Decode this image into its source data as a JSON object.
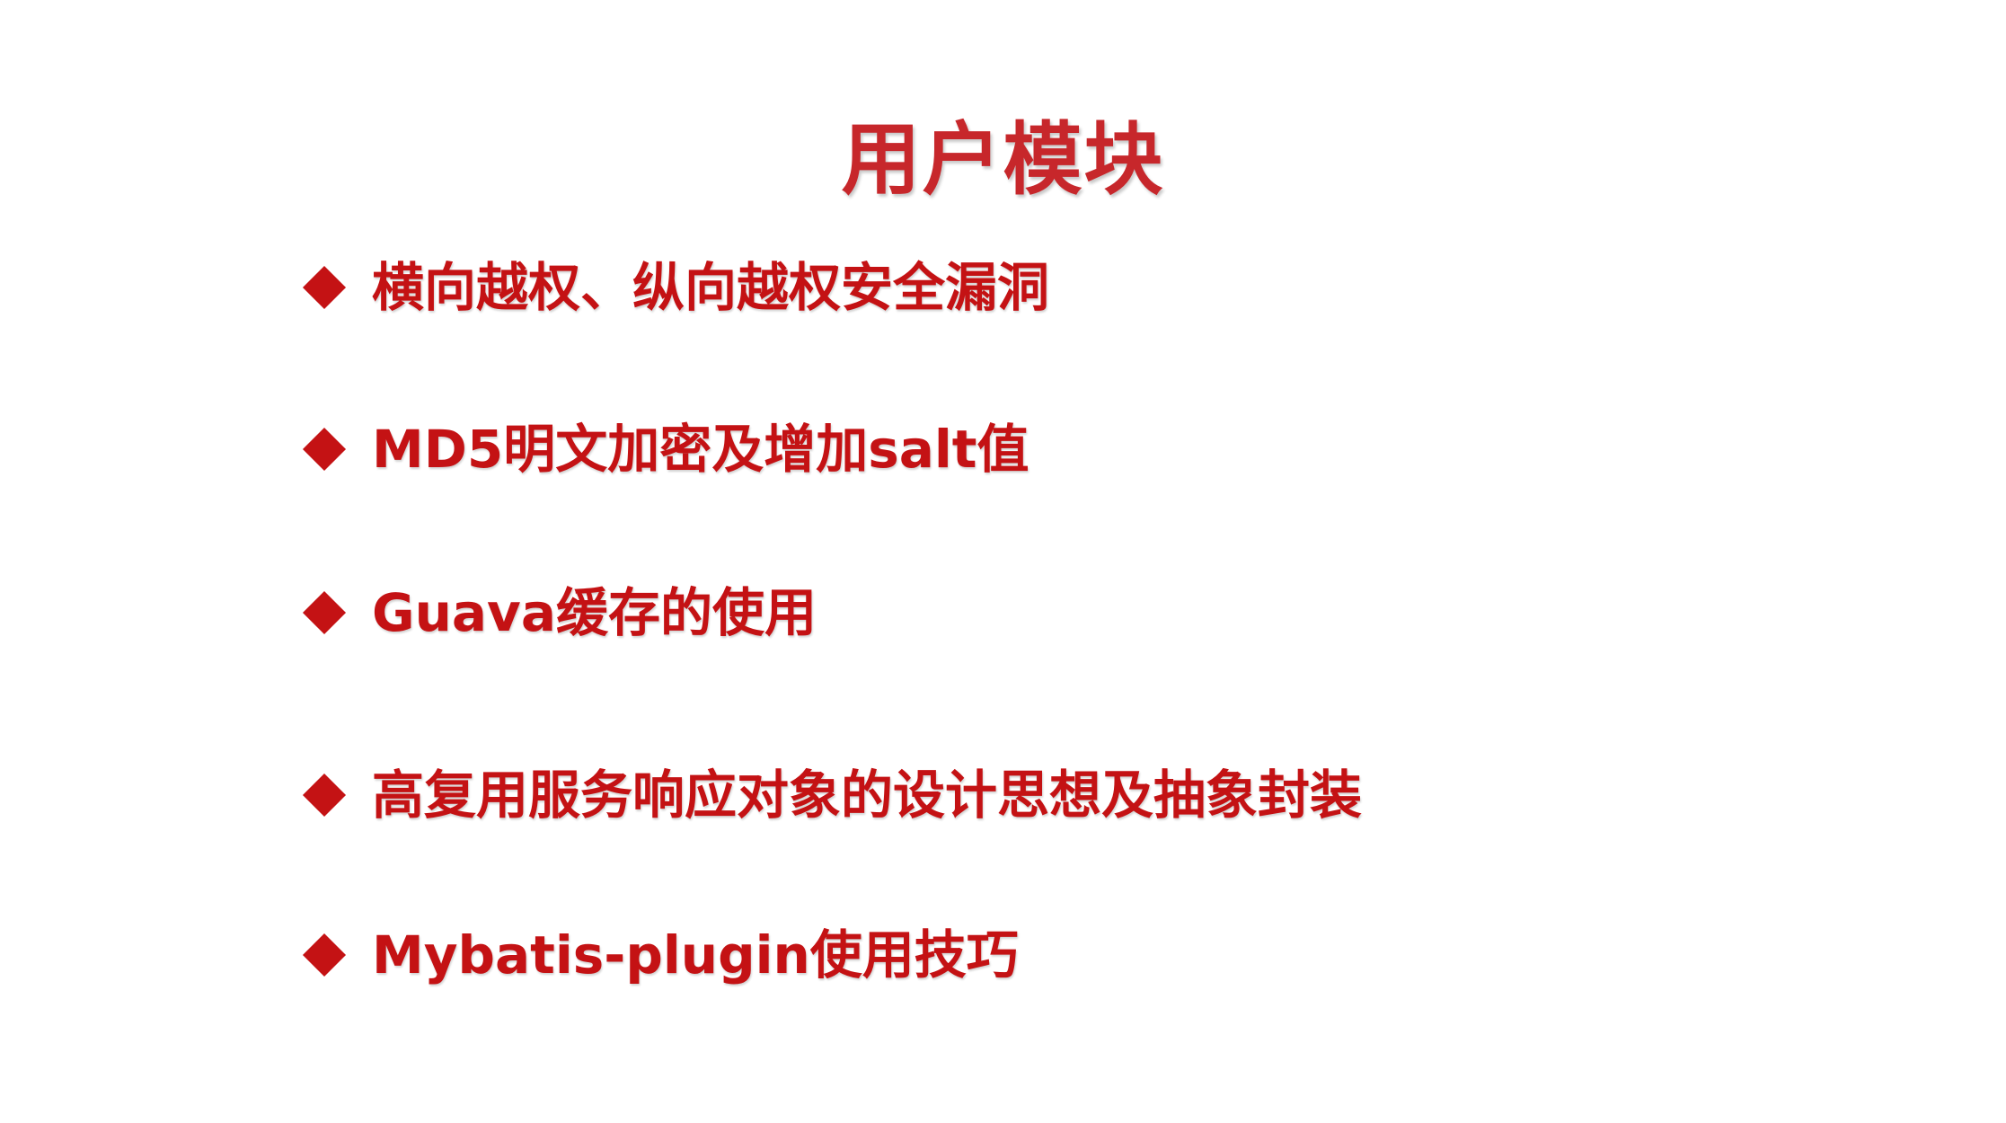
{
  "colors": {
    "accent": "#c41214",
    "title": "#c7272b",
    "background": "#ffffff"
  },
  "slide": {
    "title": "用户模块",
    "bullets": [
      {
        "icon": "diamond-icon",
        "text": "横向越权、纵向越权安全漏洞"
      },
      {
        "icon": "diamond-icon",
        "text": "MD5明文加密及增加salt值"
      },
      {
        "icon": "diamond-icon",
        "text": "Guava缓存的使用"
      },
      {
        "icon": "diamond-icon",
        "text": "高复用服务响应对象的设计思想及抽象封装"
      },
      {
        "icon": "diamond-icon",
        "text": "Mybatis-plugin使用技巧"
      }
    ]
  }
}
